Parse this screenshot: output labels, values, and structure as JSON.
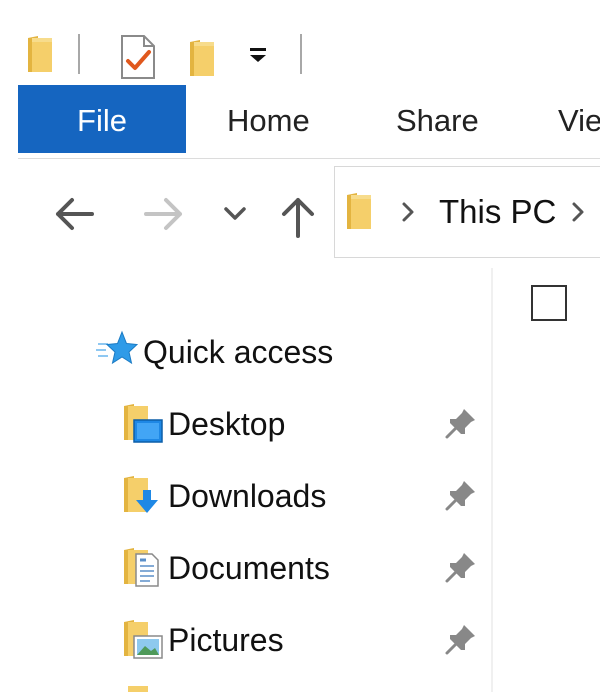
{
  "window": {
    "quick_access_toolbar": [
      "folder-icon",
      "properties-icon",
      "new-folder-icon",
      "customize-dropdown-icon"
    ]
  },
  "ribbon": {
    "tabs": [
      {
        "label": "File",
        "active": true
      },
      {
        "label": "Home"
      },
      {
        "label": "Share"
      },
      {
        "label": "Vie"
      }
    ]
  },
  "nav": {
    "back_icon": "arrow-left-icon",
    "forward_icon": "arrow-right-icon",
    "recent_icon": "chevron-down-icon",
    "up_icon": "arrow-up-icon"
  },
  "address_bar": {
    "location": "This PC"
  },
  "nav_pane": {
    "quick_access": "Quick access",
    "items": [
      {
        "label": "Desktop",
        "icon": "desktop-folder-icon",
        "pinned": true
      },
      {
        "label": "Downloads",
        "icon": "downloads-folder-icon",
        "pinned": true
      },
      {
        "label": "Documents",
        "icon": "documents-folder-icon",
        "pinned": true
      },
      {
        "label": "Pictures",
        "icon": "pictures-folder-icon",
        "pinned": true
      }
    ]
  },
  "colors": {
    "accent": "#1565c0",
    "folder": "#f5cf6a",
    "folder_dark": "#e3b440",
    "star": "#2f9be8"
  }
}
